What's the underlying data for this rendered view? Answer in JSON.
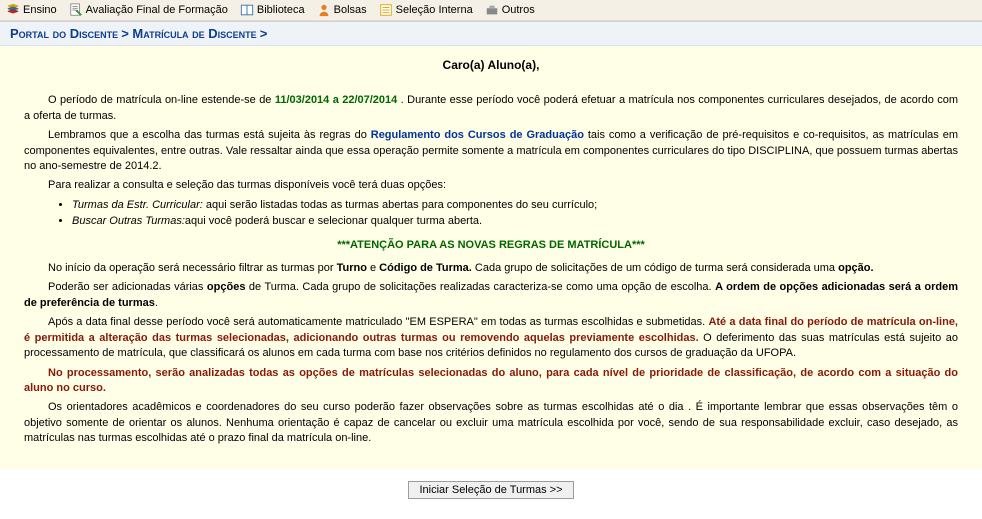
{
  "navbar": {
    "ensino": "Ensino",
    "avaliacao": "Avaliação Final de Formação",
    "biblioteca": "Biblioteca",
    "bolsas": "Bolsas",
    "selecao": "Seleção Interna",
    "outros": "Outros"
  },
  "breadcrumb": {
    "portal": "Portal do Discente",
    "sep1": " > ",
    "matricula": "Matrícula de Discente",
    "sep2": " >"
  },
  "content": {
    "greeting": "Caro(a) Aluno(a),",
    "p1a": "O período de matrícula on-line estende-se de ",
    "p1_date": "11/03/2014 a 22/07/2014",
    "p1b": " . Durante esse período você poderá efetuar a matrícula nos componentes curriculares desejados, de acordo com a oferta de turmas.",
    "p2a": "Lembramos que a escolha das turmas está sujeita às regras do ",
    "p2_link": "Regulamento dos Cursos de Graduação",
    "p2b": " tais como a verificação de pré-requisitos e co-requisitos, as matrículas em componentes equivalentes, entre outras. Vale ressaltar ainda que essa operação permite somente a matrícula em componentes curriculares do tipo DISCIPLINA, que possuem turmas abertas no ano-semestre de 2014.2.",
    "p3": "Para realizar a consulta e seleção das turmas disponíveis você terá duas opções:",
    "li1a": "Turmas da Estr. Curricular:",
    "li1b": " aqui serão listadas todas as turmas abertas para componentes do seu currículo;",
    "li2a": "Buscar Outras Turmas:",
    "li2b": "aqui você poderá buscar e selecionar qualquer turma aberta.",
    "attn": "***ATENÇÃO PARA AS NOVAS REGRAS DE MATRÍCULA***",
    "p4a": "No início da operação será necessário filtrar as turmas por ",
    "p4b": "Turno",
    "p4c": " e ",
    "p4d": "Código de Turma.",
    "p4e": " Cada grupo de solicitações de um código de turma será considerada uma ",
    "p4f": "opção.",
    "p5a": "Poderão ser adicionadas várias ",
    "p5b": "opções",
    "p5c": " de Turma. Cada grupo de solicitações realizadas caracteriza-se como uma opção de escolha. ",
    "p5d": "A ordem de opções adicionadas será a ordem de preferência de turmas",
    "p5e": ".",
    "p6a": "Após a data final desse período você será automaticamente matriculado \"EM ESPERA\" em todas as turmas escolhidas e submetidas. ",
    "p6b": "Até a data final do período de matrícula on-line, é permitida a alteração das turmas selecionadas, adicionando outras turmas ou removendo aquelas previamente escolhidas.",
    "p6c": " O deferimento das suas matrículas está sujeito ao processamento de matrícula, que classificará os alunos em cada turma com base nos critérios definidos no regulamento dos cursos de graduação da UFOPA.",
    "p7": "No processamento, serão analizadas todas as opções de matrículas selecionadas do aluno, para cada nível de prioridade de classificação, de acordo com a situação do aluno no curso.",
    "p8": "Os orientadores acadêmicos e coordenadores do seu curso poderão fazer observações sobre as turmas escolhidas até o dia . É importante lembrar que essas observações têm o objetivo somente de orientar os alunos. Nenhuma orientação é capaz de cancelar ou excluir uma matrícula escolhida por você, sendo de sua responsabilidade excluir, caso desejado, as matrículas nas turmas escolhidas até o prazo final da matrícula on-line."
  },
  "actions": {
    "start": "Iniciar Seleção de Turmas >>"
  }
}
